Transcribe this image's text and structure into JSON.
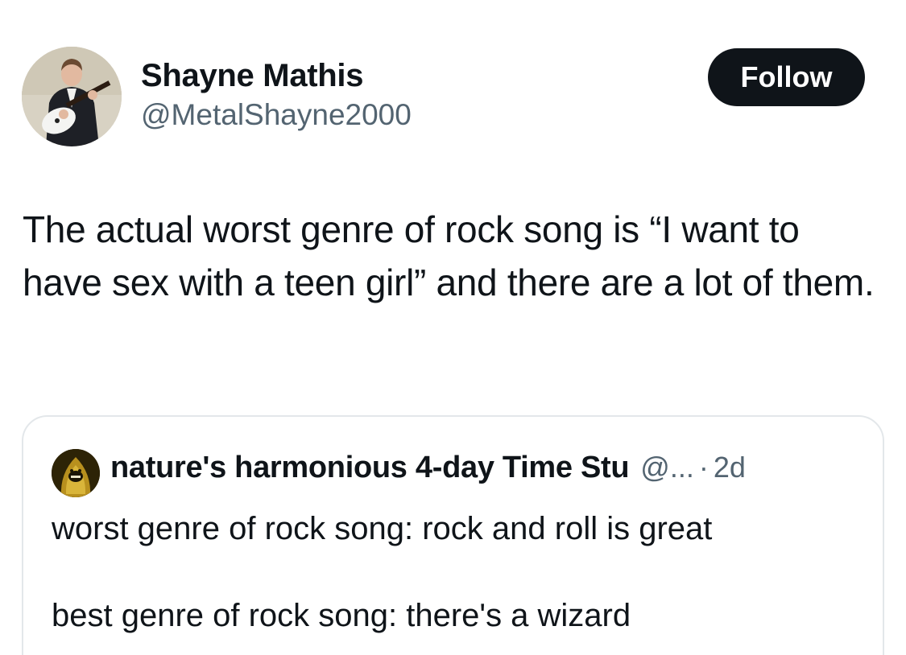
{
  "author": {
    "display_name": "Shayne Mathis",
    "handle": "@MetalShayne2000",
    "avatar_icon": "profile-photo-guitarist"
  },
  "follow_label": "Follow",
  "tweet": {
    "text": "The actual worst genre of rock song is “I want to have sex with a teen girl” and there are a lot of them."
  },
  "quote": {
    "display_name": "nature's harmonious 4-day Time Stu",
    "handle": "@...",
    "separator": "·",
    "time": "2d",
    "avatar_icon": "profile-photo-gold-figure",
    "text": "worst genre of rock song: rock and roll is great\n\nbest genre of rock song: there's a wizard"
  },
  "colors": {
    "text_primary": "#0f1419",
    "text_secondary": "#536471",
    "follow_bg": "#0f1419",
    "border": "#e3e7ea"
  }
}
